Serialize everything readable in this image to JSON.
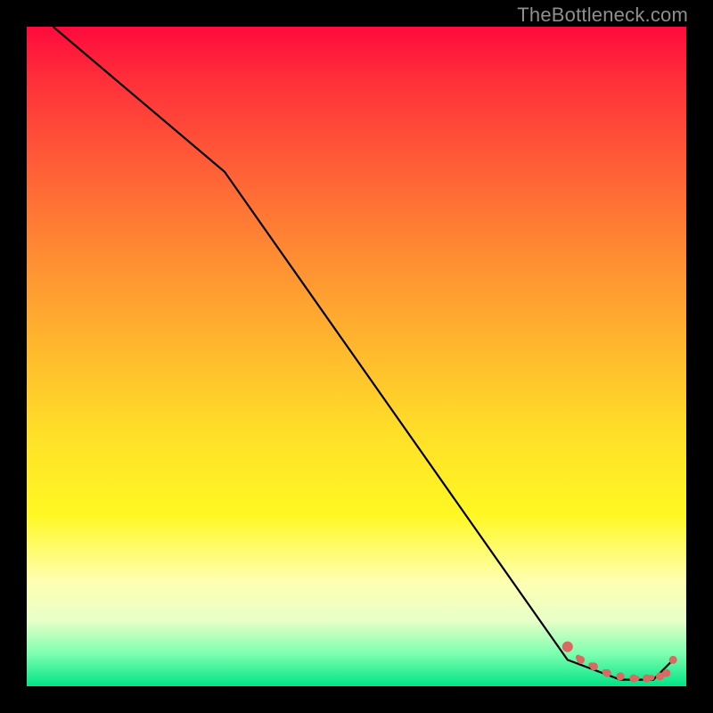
{
  "watermark": "TheBottleneck.com",
  "chart_data": {
    "type": "line",
    "title": "",
    "xlabel": "",
    "ylabel": "",
    "xlim": [
      0,
      100
    ],
    "ylim": [
      0,
      100
    ],
    "background": "heatmap-vertical-red-to-green",
    "series": [
      {
        "name": "bottleneck-curve",
        "style": "solid-black",
        "x": [
          4,
          30,
          82,
          90,
          95,
          98
        ],
        "y": [
          100,
          78,
          4,
          1,
          1,
          4
        ]
      },
      {
        "name": "highlight-segment",
        "style": "dashed-red-dots",
        "x": [
          82,
          84,
          86,
          88,
          90,
          92,
          94,
          96,
          97
        ],
        "y": [
          6,
          4,
          3,
          2,
          1.5,
          1.2,
          1.2,
          1.5,
          2
        ]
      }
    ],
    "annotations": []
  },
  "colors": {
    "line": "#000000",
    "dots": "#d96a62",
    "dash": "#d96a62"
  }
}
